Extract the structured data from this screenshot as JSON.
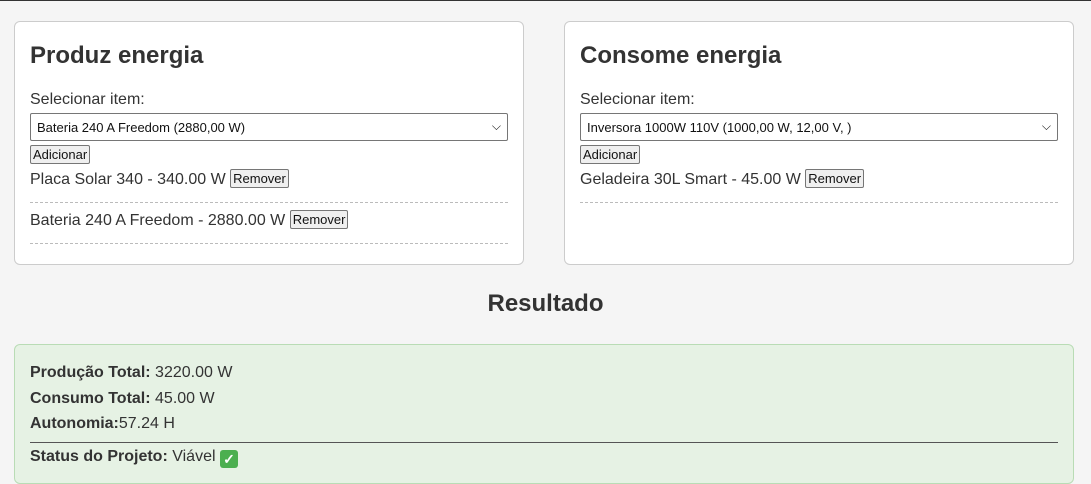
{
  "produce": {
    "title": "Produz energia",
    "select_label": "Selecionar item:",
    "selected_option": "Bateria 240 A Freedom (2880,00 W)",
    "add_label": "Adicionar",
    "items": [
      {
        "text": "Placa Solar 340 - 340.00 W",
        "remove_label": "Remover"
      },
      {
        "text": "Bateria 240 A Freedom - 2880.00 W",
        "remove_label": "Remover"
      }
    ]
  },
  "consume": {
    "title": "Consome energia",
    "select_label": "Selecionar item:",
    "selected_option": "Inversora 1000W 110V (1000,00 W, 12,00 V, )",
    "add_label": "Adicionar",
    "items": [
      {
        "text": "Geladeira 30L Smart - 45.00 W",
        "remove_label": "Remover"
      }
    ]
  },
  "result": {
    "title": "Resultado",
    "production_label": "Produção Total:",
    "production_value": "3220.00 W",
    "consumption_label": "Consumo Total:",
    "consumption_value": "45.00 W",
    "autonomy_label": "Autonomia:",
    "autonomy_value": "57.24 H",
    "status_label": "Status do Projeto:",
    "status_value": "Viável",
    "status_icon": "check-mark-icon",
    "status_color": "#4caf50"
  }
}
